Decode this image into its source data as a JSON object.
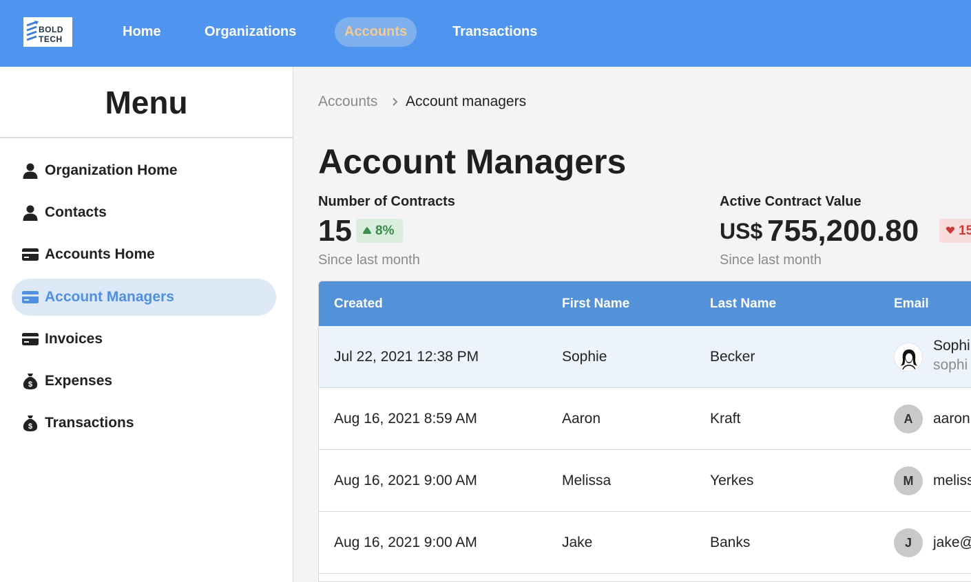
{
  "header": {
    "logo": {
      "line1": "BOLD",
      "line2": "TECH"
    },
    "nav": [
      {
        "label": "Home",
        "active": false
      },
      {
        "label": "Organizations",
        "active": false
      },
      {
        "label": "Accounts",
        "active": true
      },
      {
        "label": "Transactions",
        "active": false
      }
    ]
  },
  "sidebar": {
    "title": "Menu",
    "items": [
      {
        "label": "Organization Home",
        "icon": "person-icon",
        "active": false
      },
      {
        "label": "Contacts",
        "icon": "person-icon",
        "active": false
      },
      {
        "label": "Accounts Home",
        "icon": "credit-card-icon",
        "active": false
      },
      {
        "label": "Account Managers",
        "icon": "credit-card-icon",
        "active": true
      },
      {
        "label": "Invoices",
        "icon": "credit-card-icon",
        "active": false
      },
      {
        "label": "Expenses",
        "icon": "money-bag-icon",
        "active": false
      },
      {
        "label": "Transactions",
        "icon": "money-bag-icon",
        "active": false
      }
    ]
  },
  "breadcrumb": {
    "parent": "Accounts",
    "separator": "›",
    "current": "Account managers"
  },
  "page_title": "Account Managers",
  "stats": [
    {
      "label": "Number of Contracts",
      "prefix": "",
      "value": "15",
      "change": "8%",
      "direction": "up",
      "sub": "Since last month"
    },
    {
      "label": "Active Contract Value",
      "prefix": "US$",
      "value": "755,200.80",
      "change": "15",
      "direction": "down",
      "sub": "Since last month"
    }
  ],
  "table": {
    "columns": [
      "Created",
      "First Name",
      "Last Name",
      "Email"
    ],
    "rows": [
      {
        "created": "Jul 22, 2021 12:38 PM",
        "first": "Sophie",
        "last": "Becker",
        "avatar": "",
        "email_name": "Sophi",
        "email": "sophi",
        "highlight": true
      },
      {
        "created": "Aug 16, 2021 8:59 AM",
        "first": "Aaron",
        "last": "Kraft",
        "avatar": "A",
        "email": "aaron",
        "highlight": false
      },
      {
        "created": "Aug 16, 2021 9:00 AM",
        "first": "Melissa",
        "last": "Yerkes",
        "avatar": "M",
        "email": "meliss",
        "highlight": false
      },
      {
        "created": "Aug 16, 2021 9:00 AM",
        "first": "Jake",
        "last": "Banks",
        "avatar": "J",
        "email": "jake@",
        "highlight": false
      }
    ]
  },
  "colors": {
    "header_bg": "#4f95f0",
    "active_nav_text": "#f6c98f",
    "sidebar_active_bg": "#dde8f7",
    "table_header_bg": "#5391d8",
    "up_green": "#3d8a4c",
    "down_red": "#cc3b3b"
  }
}
